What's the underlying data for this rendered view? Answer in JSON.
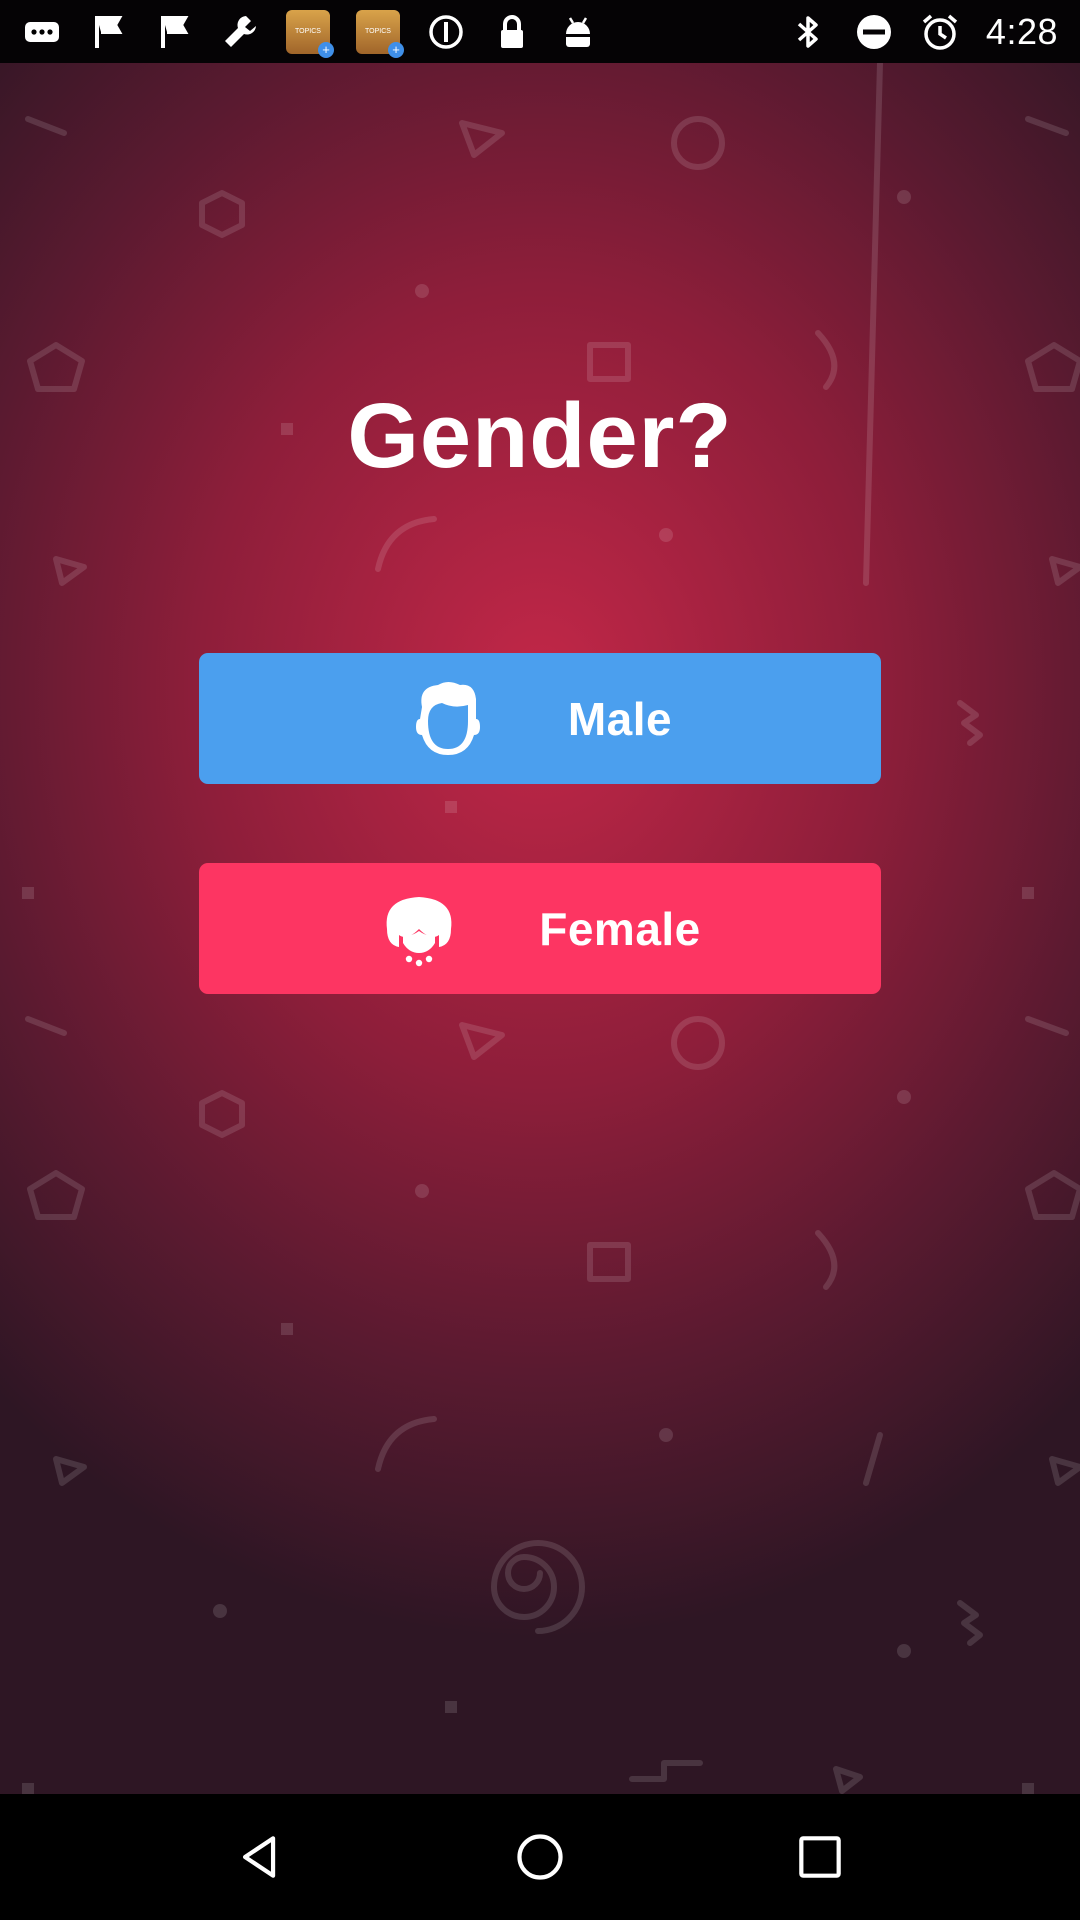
{
  "status_bar": {
    "time": "4:28",
    "notification_app_label": "TOPICS",
    "left_icons": [
      "more-icon",
      "flag-icon",
      "flag-icon",
      "wrench-icon",
      "app-notification-icon",
      "app-notification-icon",
      "circle-info-icon",
      "lock-icon",
      "android-icon"
    ],
    "right_icons": [
      "bluetooth-icon",
      "do-not-disturb-icon",
      "alarm-icon"
    ]
  },
  "page": {
    "title": "Gender?"
  },
  "options": {
    "male_label": "Male",
    "female_label": "Female"
  },
  "colors": {
    "male_button": "#4b9fee",
    "female_button": "#fd3562",
    "background_center": "#c22748",
    "background_edge": "#2e1624"
  },
  "nav_bar": {
    "icons": [
      "back-icon",
      "home-icon",
      "recents-icon"
    ]
  }
}
